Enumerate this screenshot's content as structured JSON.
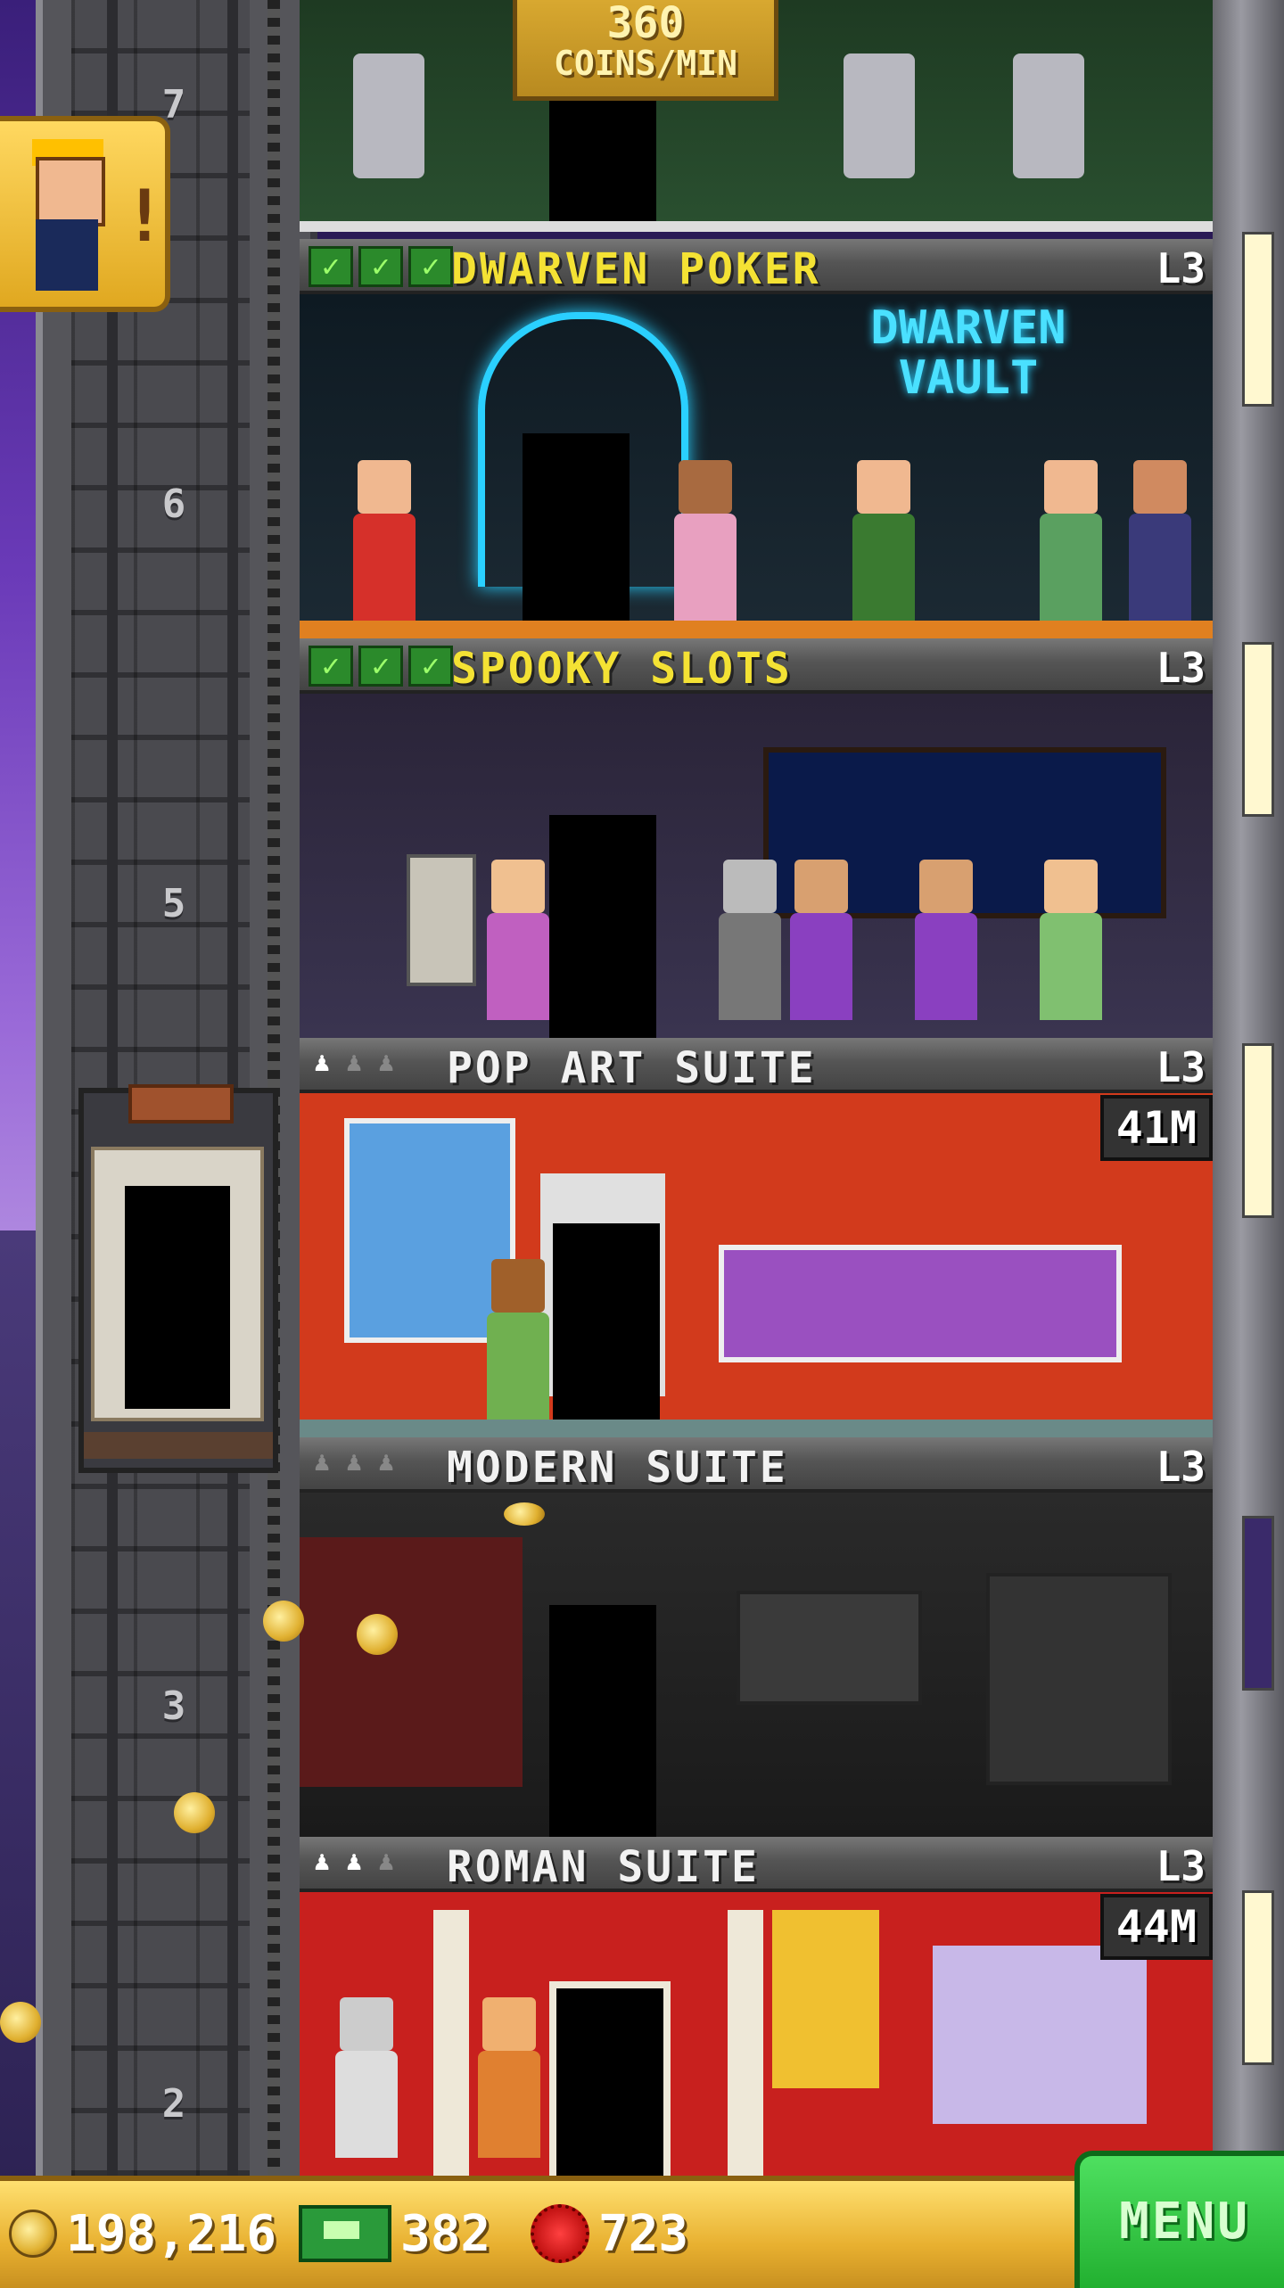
{
  "tower": {
    "coins_rate": {
      "value": "360",
      "unit": "COINS/MIN"
    },
    "floors": [
      {
        "name": "DWARVEN POKER",
        "level": "L3",
        "status": "stocked",
        "checks": 3,
        "sign": "DWARVEN\nVAULT"
      },
      {
        "name": "SPOOKY SLOTS",
        "level": "L3",
        "status": "stocked",
        "checks": 3
      },
      {
        "name": "POP ART SUITE",
        "level": "L3",
        "status": "residential",
        "residents": 1,
        "timer": "41M"
      },
      {
        "name": "MODERN SUITE",
        "level": "L3",
        "status": "residential",
        "residents": 0
      },
      {
        "name": "ROMAN SUITE",
        "level": "L3",
        "status": "residential",
        "residents": 2,
        "timer": "44M"
      }
    ],
    "elevator_floor_numbers": [
      "7",
      "6",
      "5",
      "3",
      "2"
    ]
  },
  "bottom_bar": {
    "coins": "198,216",
    "bux": "382",
    "gems": "723",
    "menu_label": "MENU"
  },
  "colors": {
    "completed_name": "#f4e234",
    "residential_name": "#f2f2f2",
    "menu_button": "#2ec43e",
    "check_green": "#2b8a2b"
  }
}
